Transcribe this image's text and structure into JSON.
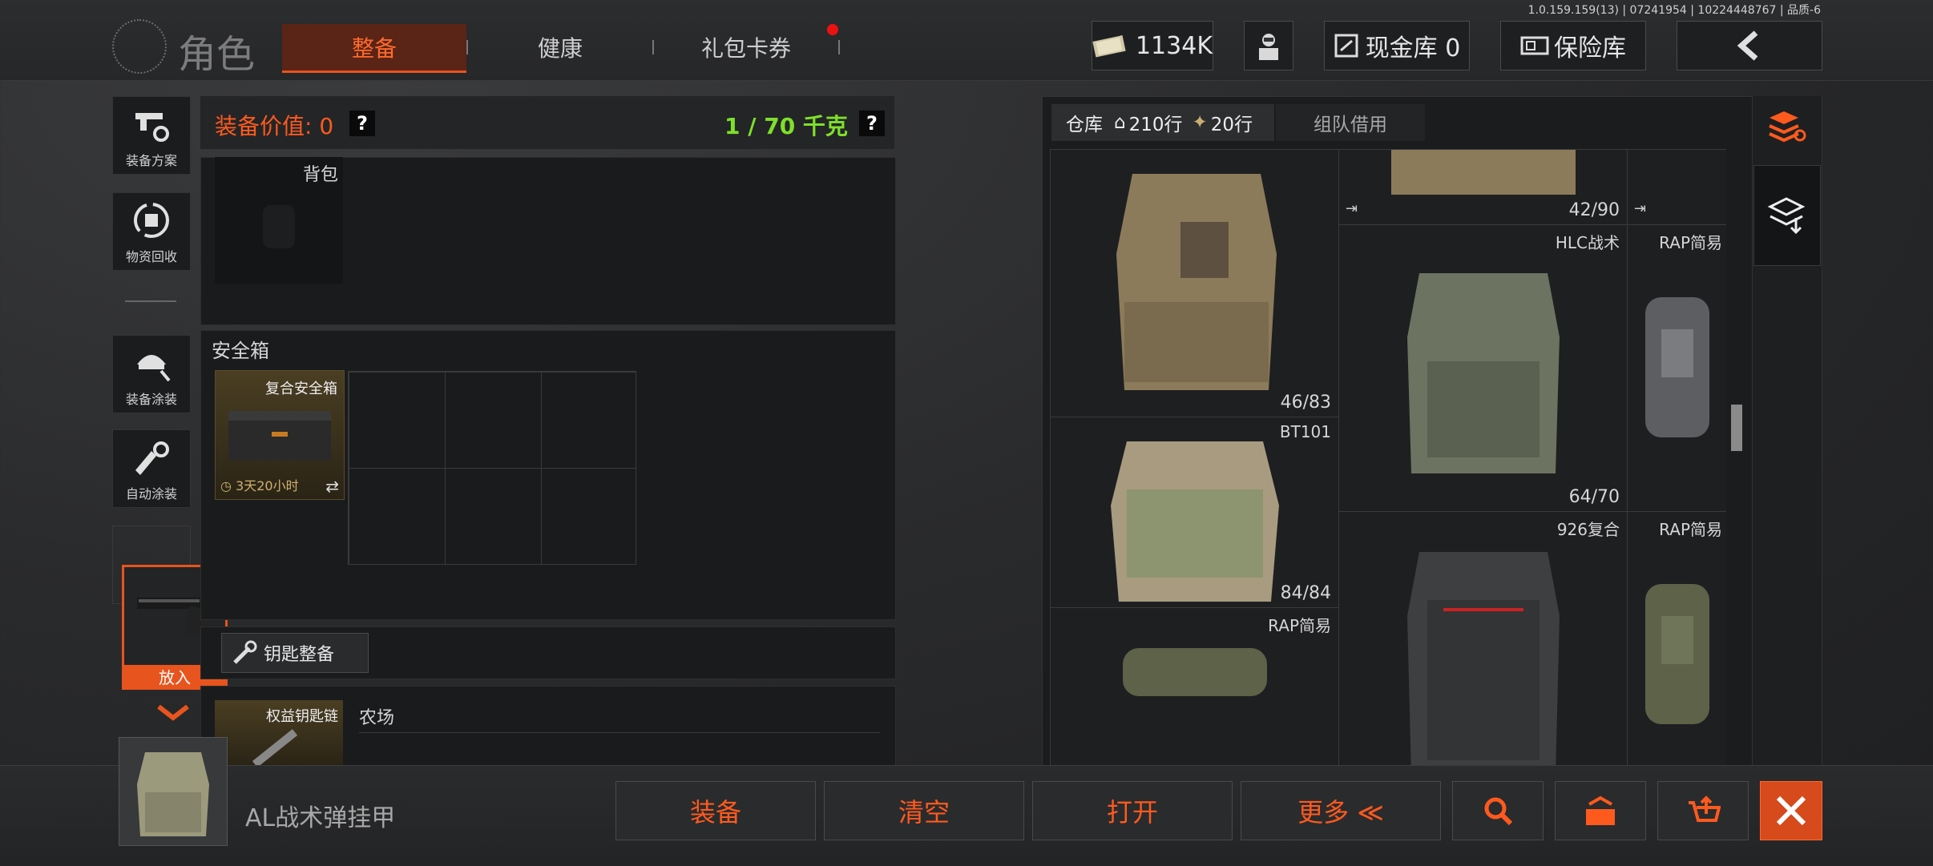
{
  "version": "1.0.159.159(13) | 07241954 | 10224448767 | 品质-6",
  "header": {
    "title": "角色",
    "tabs": [
      "整备",
      "健康",
      "礼包卡券"
    ],
    "money": "1134K",
    "cash_vault": "现金库 0",
    "safe_vault": "保险库"
  },
  "sidebar": {
    "items": [
      "装备方案",
      "物资回收",
      "装备涂装",
      "自动涂装"
    ]
  },
  "loadout": {
    "value_label": "装备价值: 0",
    "weight_label": "1 / 70 千克",
    "help": "?",
    "backpack_label": "背包",
    "safebox_title": "安全箱",
    "safebox_item": "复合安全箱",
    "safebox_timer": "3天20小时",
    "key_button": "钥匙整备",
    "key_item": "权益钥匙链",
    "map_label": "农场",
    "drag_label": "放入"
  },
  "warehouse": {
    "tab_label": "仓库",
    "home_rows": "210行",
    "cash_rows": "20行",
    "team_tab": "组队借用",
    "cells": [
      {
        "label": "",
        "count": "46/83"
      },
      {
        "label": "",
        "count": "42/90"
      },
      {
        "label": "HLC战术",
        "count": "64/70"
      },
      {
        "label": "RAP简易",
        "count": ""
      },
      {
        "label": "BT101",
        "count": "84/84"
      },
      {
        "label": "926复合",
        "count": ""
      },
      {
        "label": "RAP简易",
        "count": ""
      },
      {
        "label": "RAP简易",
        "count": ""
      }
    ]
  },
  "selected": {
    "name": "AL战术弹挂甲"
  },
  "actions": {
    "equip": "装备",
    "clear": "清空",
    "open": "打开",
    "more": "更多 ≪"
  },
  "colors": {
    "accent": "#ff5a1e",
    "weight_green": "#7ee02a"
  }
}
